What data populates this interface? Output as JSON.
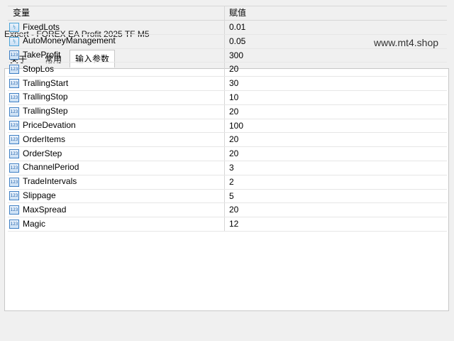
{
  "window": {
    "title": "Expert - FOREX EA Profit 2025 TF M5",
    "watermark": "www.mt4.shop"
  },
  "tabs": [
    {
      "label": "关于"
    },
    {
      "label": "常用"
    },
    {
      "label": "输入参数",
      "active": true
    }
  ],
  "grid": {
    "columns": {
      "variable": "变量",
      "value": "赋值"
    },
    "rows": [
      {
        "name": "FixedLots",
        "value": "0.01",
        "type_icon": "double-type-icon"
      },
      {
        "name": "AutoMoneyManagement",
        "value": "0.05",
        "type_icon": "double-type-icon"
      },
      {
        "name": "TakeProfit",
        "value": "300",
        "type_icon": "integer-type-icon"
      },
      {
        "name": "StopLos",
        "value": "20",
        "type_icon": "integer-type-icon"
      },
      {
        "name": "TrallingStart",
        "value": "30",
        "type_icon": "integer-type-icon"
      },
      {
        "name": "TrallingStop",
        "value": "10",
        "type_icon": "integer-type-icon"
      },
      {
        "name": "TrallingStep",
        "value": "20",
        "type_icon": "integer-type-icon"
      },
      {
        "name": "PriceDevation",
        "value": "100",
        "type_icon": "integer-type-icon"
      },
      {
        "name": "OrderItems",
        "value": "20",
        "type_icon": "integer-type-icon"
      },
      {
        "name": "OrderStep",
        "value": "20",
        "type_icon": "integer-type-icon"
      },
      {
        "name": "ChannelPeriod",
        "value": "3",
        "type_icon": "integer-type-icon"
      },
      {
        "name": "TradeIntervals",
        "value": "2",
        "type_icon": "integer-type-icon"
      },
      {
        "name": "Slippage",
        "value": "5",
        "type_icon": "integer-type-icon"
      },
      {
        "name": "MaxSpread",
        "value": "20",
        "type_icon": "integer-type-icon"
      },
      {
        "name": "Magic",
        "value": "12",
        "type_icon": "integer-type-icon"
      }
    ]
  },
  "colors": {
    "panel_bg": "#ffffff",
    "window_bg": "#f0f0f0",
    "icon_accent": "#3f7fc3"
  }
}
